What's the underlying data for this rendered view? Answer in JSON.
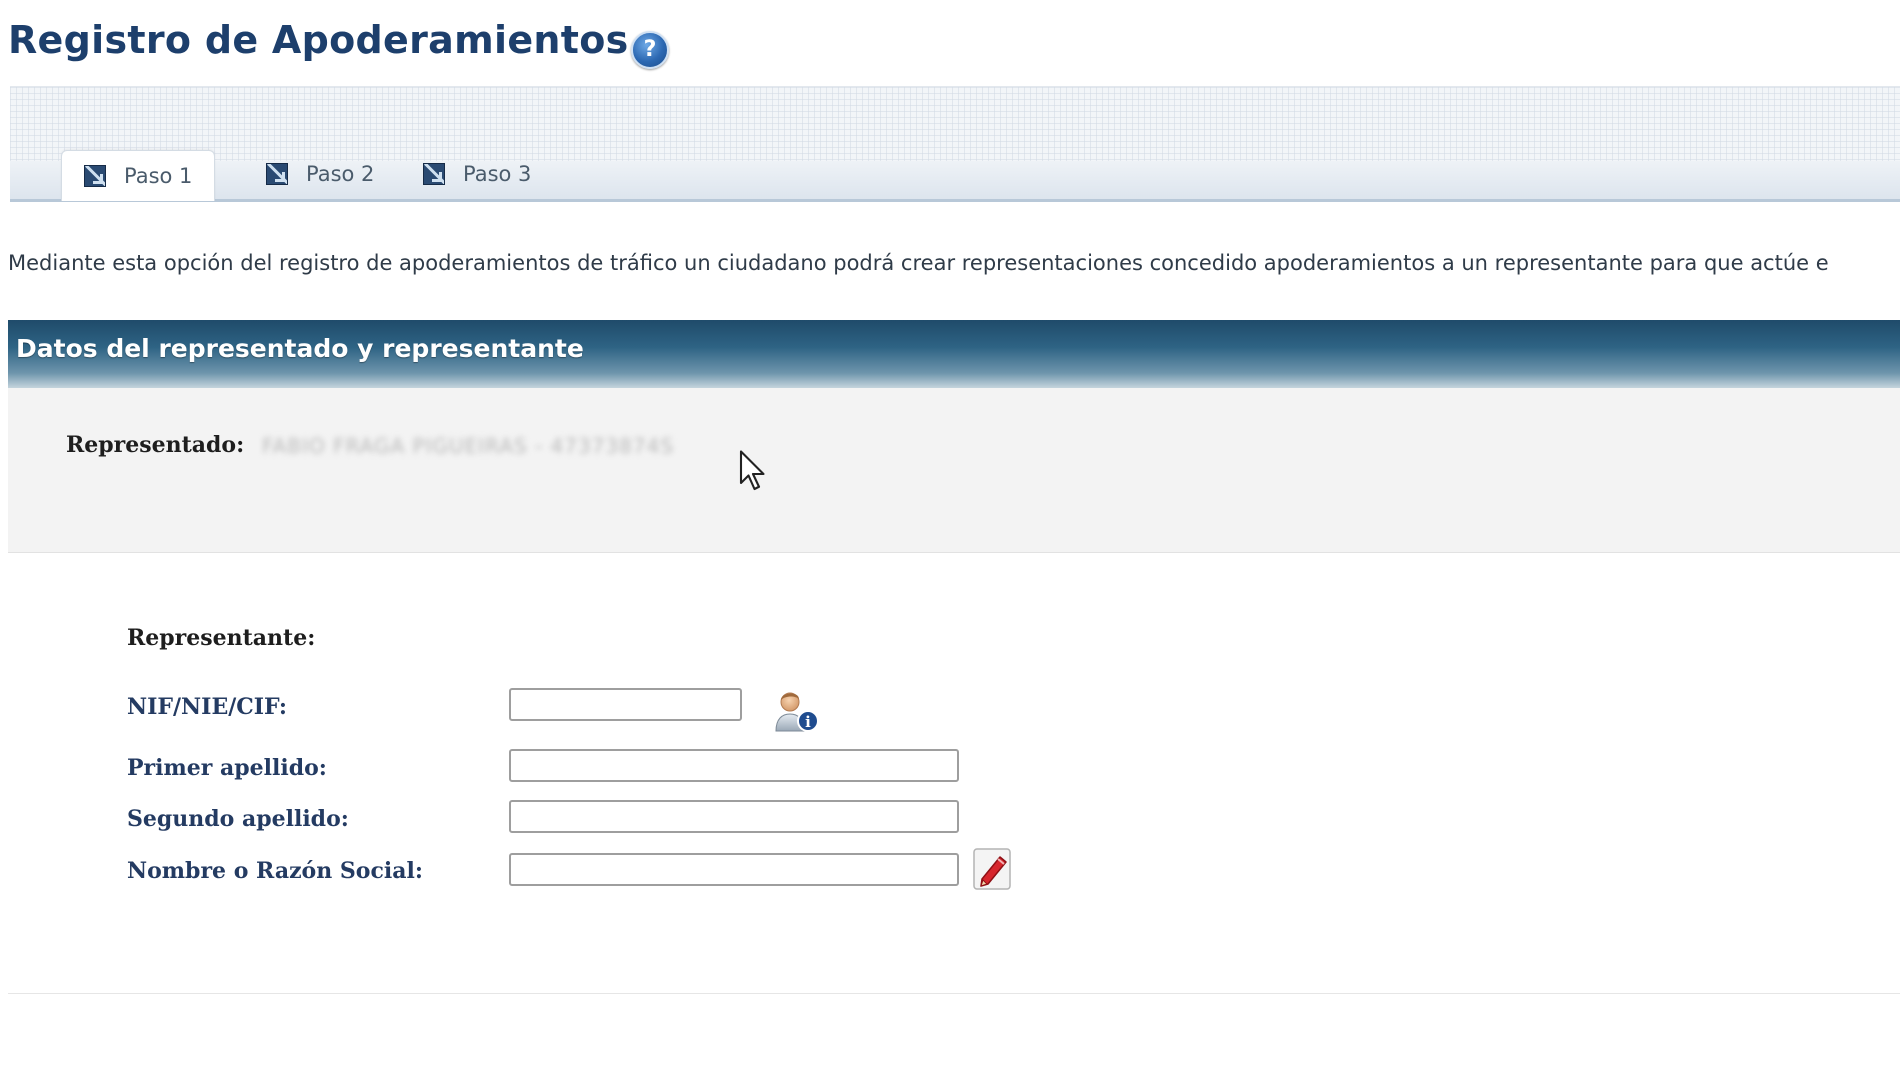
{
  "header": {
    "title": "Registro de Apoderamientos",
    "help_icon": "help-icon"
  },
  "tabs": [
    {
      "label": "Paso 1",
      "active": true,
      "icon": "step-arrow-icon"
    },
    {
      "label": "Paso 2",
      "active": false,
      "icon": "step-arrow-icon"
    },
    {
      "label": "Paso 3",
      "active": false,
      "icon": "step-arrow-icon"
    }
  ],
  "description": "Mediante esta opción del registro de apoderamientos de tráfico un ciudadano podrá crear representaciones concedido apoderamientos a un representante para que actúe e",
  "section": {
    "title": "Datos del representado y representante"
  },
  "representado": {
    "label": "Representado:",
    "value": "FABIO FRAGA PIGUEIRAS - 47373874S",
    "value_blurred": true
  },
  "representante": {
    "heading": "Representante:",
    "fields": {
      "nif": {
        "label": "NIF/NIE/CIF:",
        "value": ""
      },
      "primer_apellido": {
        "label": "Primer apellido:",
        "value": ""
      },
      "segundo_apellido": {
        "label": "Segundo apellido:",
        "value": ""
      },
      "nombre": {
        "label": "Nombre o Razón Social:",
        "value": ""
      }
    },
    "lookup_icon": "person-info-icon",
    "edit_icon": "pencil-edit-icon"
  },
  "colors": {
    "title": "#1d3f6c",
    "section_header": "#2e6384",
    "field_label": "#243b62"
  }
}
